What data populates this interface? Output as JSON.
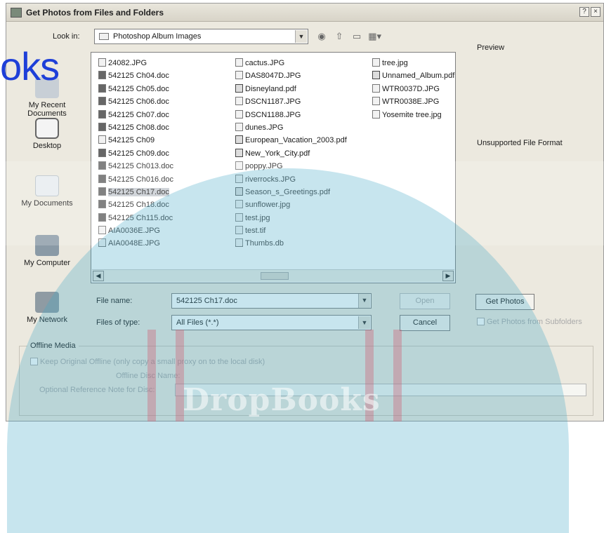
{
  "window": {
    "title": "Get Photos from Files and Folders",
    "help": "?",
    "close": "×"
  },
  "lookin": {
    "label": "Look in:",
    "value": "Photoshop Album Images"
  },
  "toolbar": {
    "icons": [
      "back-icon",
      "up-folder-icon",
      "new-folder-icon",
      "views-menu-icon"
    ]
  },
  "places": {
    "recent": "My Recent\nDocuments",
    "desktop": "Desktop",
    "documents": "My Documents",
    "computer": "My Computer",
    "network": "My Network"
  },
  "files": {
    "col1": [
      "24082.JPG",
      "542125 Ch04.doc",
      "542125 Ch05.doc",
      "542125 Ch06.doc",
      "542125 Ch07.doc",
      "542125 Ch08.doc",
      "542125 Ch09",
      "542125 Ch09.doc",
      "542125 Ch013.doc",
      "542125 Ch016.doc",
      "542125 Ch17.doc",
      "542125 Ch18.doc",
      "542125 Ch115.doc",
      "AIA0036E.JPG",
      "AIA0048E.JPG"
    ],
    "col2": [
      "cactus.JPG",
      "DAS8047D.JPG",
      "Disneyland.pdf",
      "DSCN1187.JPG",
      "DSCN1188.JPG",
      "dunes.JPG",
      "European_Vacation_2003.pdf",
      "New_York_City.pdf",
      "poppy.JPG",
      "riverrocks.JPG",
      "Season_s_Greetings.pdf",
      "sunflower.jpg",
      "test.jpg",
      "test.tif",
      "Thumbs.db"
    ],
    "col3": [
      "tree.jpg",
      "Unnamed_Album.pdf",
      "WTR0037D.JPG",
      "WTR0038E.JPG",
      "Yosemite tree.jpg"
    ]
  },
  "preview": {
    "label": "Preview",
    "message": "Unsupported File Format"
  },
  "form": {
    "file_name_label": "File name:",
    "file_name_value": "542125 Ch17.doc",
    "file_type_label": "Files of type:",
    "file_type_value": "All Files (*.*)",
    "open": "Open",
    "cancel": "Cancel",
    "get_photos": "Get Photos",
    "subfolders": "Get Photos from Subfolders"
  },
  "offline": {
    "legend": "Offline Media",
    "keep": "Keep Original Offline (only copy a small proxy on to the local disk)",
    "disc_name": "Offline Disc Name:",
    "note": "Optional Reference Note for Disc:"
  },
  "watermark": {
    "logo": "oks",
    "text": "DropBooks"
  }
}
